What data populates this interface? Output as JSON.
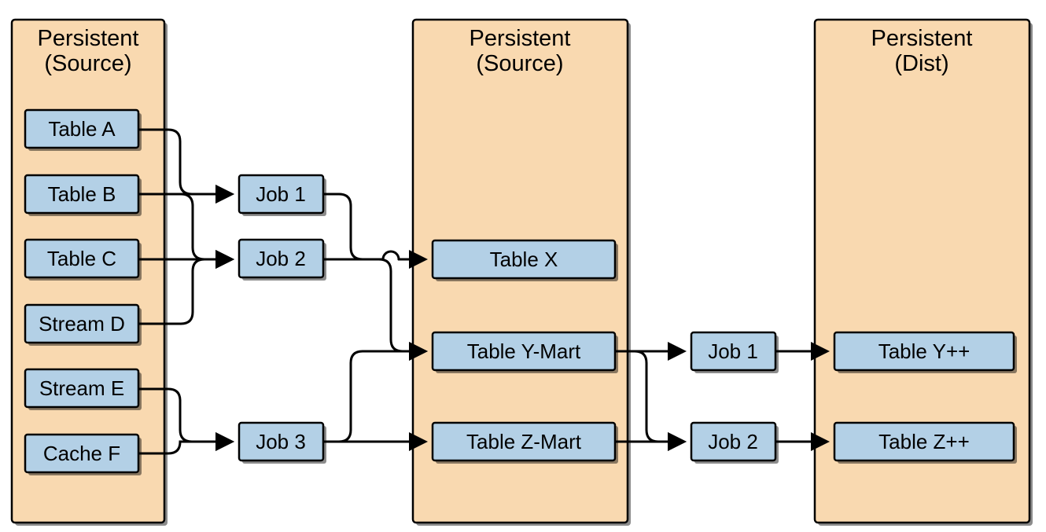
{
  "containers": {
    "source1": {
      "title_l1": "Persistent",
      "title_l2": "(Source)"
    },
    "source2": {
      "title_l1": "Persistent",
      "title_l2": "(Source)"
    },
    "dist": {
      "title_l1": "Persistent",
      "title_l2": "(Dist)"
    }
  },
  "nodes": {
    "tableA": {
      "label": "Table A"
    },
    "tableB": {
      "label": "Table B"
    },
    "tableC": {
      "label": "Table C"
    },
    "streamD": {
      "label": "Stream D"
    },
    "streamE": {
      "label": "Stream E"
    },
    "cacheF": {
      "label": "Cache F"
    },
    "job1a": {
      "label": "Job 1"
    },
    "job2a": {
      "label": "Job 2"
    },
    "job3a": {
      "label": "Job 3"
    },
    "tableX": {
      "label": "Table X"
    },
    "tableYM": {
      "label": "Table Y-Mart"
    },
    "tableZM": {
      "label": "Table Z-Mart"
    },
    "job1b": {
      "label": "Job 1"
    },
    "job2b": {
      "label": "Job 2"
    },
    "tableYpp": {
      "label": "Table Y++"
    },
    "tableZpp": {
      "label": "Table Z++"
    }
  }
}
